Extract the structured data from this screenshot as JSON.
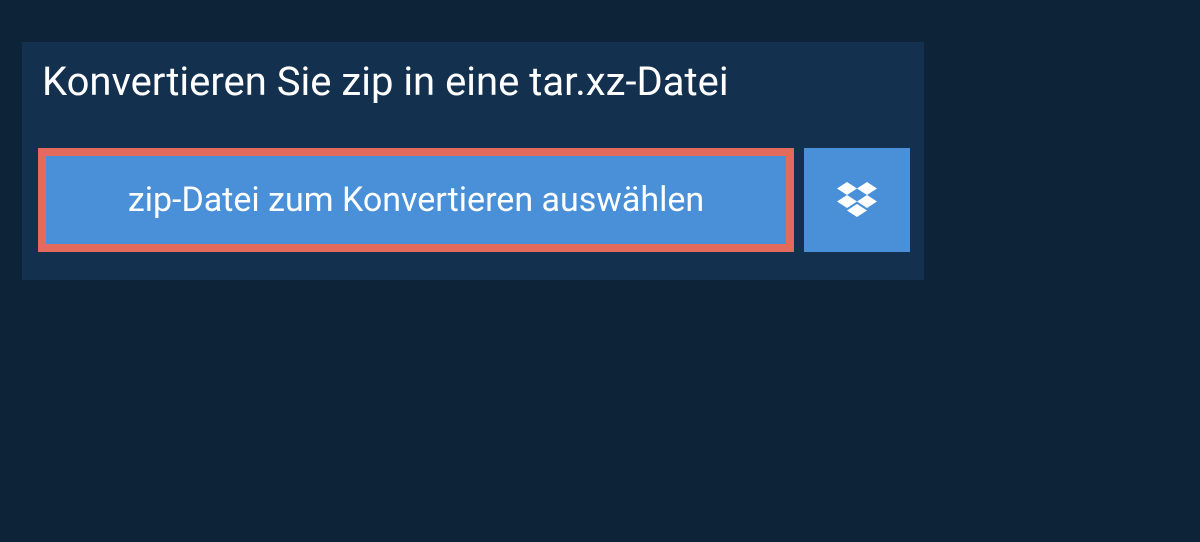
{
  "heading": "Konvertieren Sie zip in eine tar.xz-Datei",
  "buttons": {
    "select_file": "zip-Datei zum Konvertieren auswählen"
  }
}
